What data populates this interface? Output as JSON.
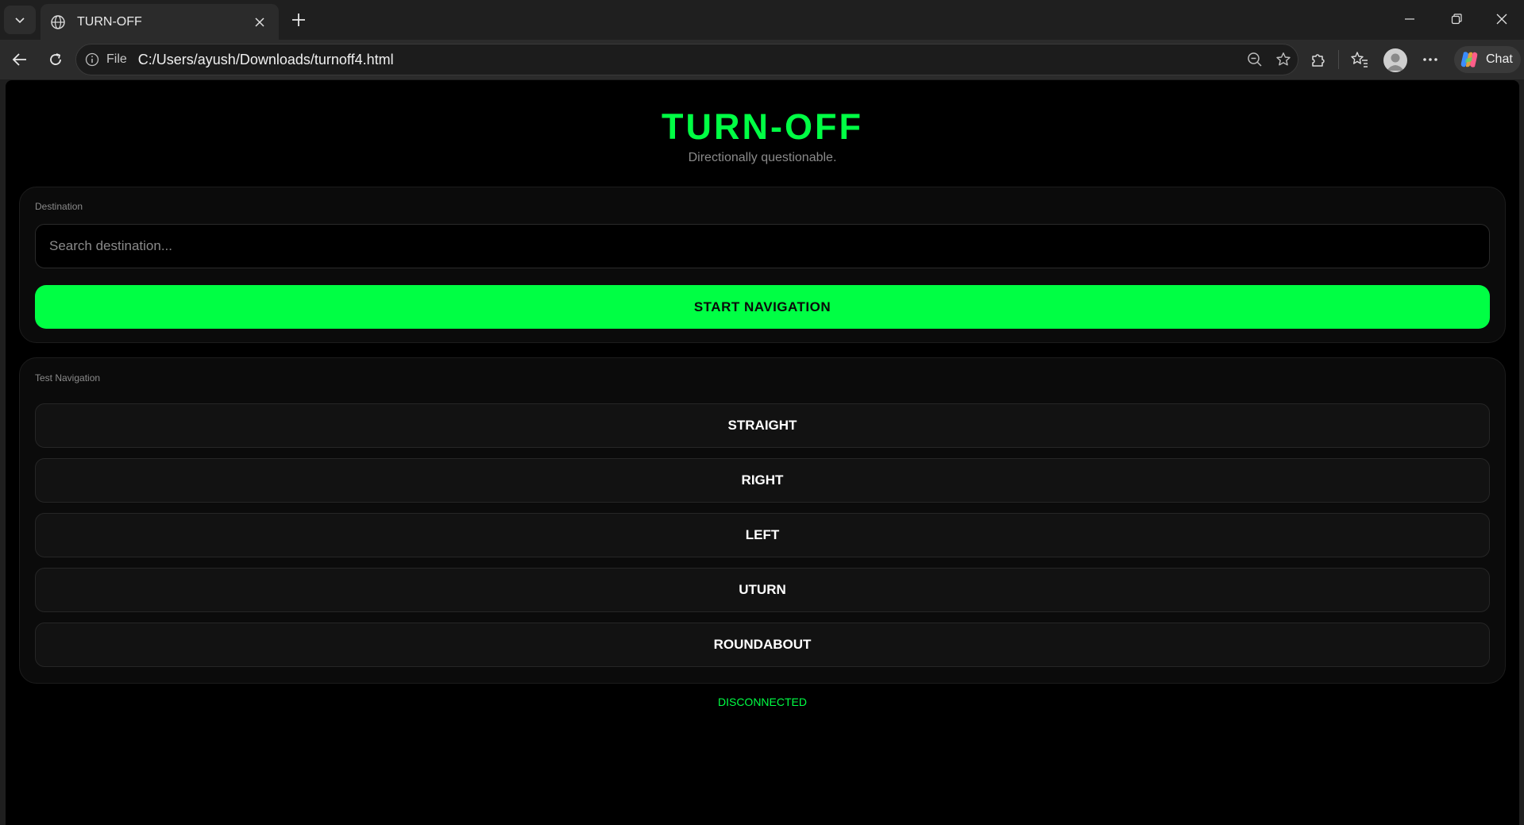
{
  "browser": {
    "tab_title": "TURN-OFF",
    "address_scheme_label": "File",
    "url": "C:/Users/ayush/Downloads/turnoff4.html",
    "chat_label": "Chat"
  },
  "page": {
    "title": "TURN-OFF",
    "subtitle": "Directionally questionable.",
    "destination": {
      "label": "Destination",
      "placeholder": "Search destination...",
      "value": ""
    },
    "start_button": "START NAVIGATION",
    "test_navigation": {
      "label": "Test Navigation",
      "buttons": [
        "STRAIGHT",
        "RIGHT",
        "LEFT",
        "UTURN",
        "ROUNDABOUT"
      ]
    },
    "status": "DISCONNECTED"
  },
  "colors": {
    "accent": "#00ff44",
    "background": "#000000",
    "card": "#0b0b0b",
    "button": "#121212"
  }
}
